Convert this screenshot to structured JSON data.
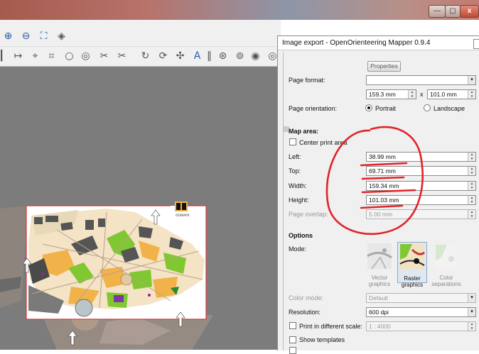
{
  "window": {
    "minimize_glyph": "—",
    "restore_glyph": "▢",
    "close_glyph": "x"
  },
  "toolbar": {
    "icons": [
      "zoom-in-icon",
      "zoom-out-icon",
      "fit-view-icon",
      "layer-icon"
    ]
  },
  "map": {
    "logo_letters": "M P S",
    "logo_caption": "OOMAPS"
  },
  "dialog": {
    "title": "Image export - OpenOrienteering Mapper 0.9.4",
    "properties_button": "Properties",
    "page_format_label": "Page format:",
    "page_format_value": "",
    "page_width": "159.3 mm",
    "page_times": "x",
    "page_height": "101.0 mm",
    "orientation_label": "Page orientation:",
    "portrait": "Portrait",
    "landscape": "Landscape",
    "map_area_heading": "Map area:",
    "center_print_area": "Center print area",
    "left_label": "Left:",
    "left_value": "38.99 mm",
    "top_label": "Top:",
    "top_value": "69.71 mm",
    "width_label": "Width:",
    "width_value": "159.34 mm",
    "height_label": "Height:",
    "height_value": "101.03 mm",
    "overlap_label": "Page overlap:",
    "overlap_value": "5.00 mm",
    "options_heading": "Options",
    "mode_label": "Mode:",
    "mode_vector": "Vector graphics",
    "mode_raster": "Raster graphics",
    "mode_color": "Color separations",
    "color_mode_label": "Color mode:",
    "color_mode_value": "Default",
    "resolution_label": "Resolution:",
    "resolution_value": "600 dpi",
    "print_scale_label": "Print in different scale:",
    "print_scale_value": "1 : 4000",
    "show_templates": "Show templates"
  },
  "colors": {
    "annotation_red": "#e0232a",
    "print_frame": "#d33a3a",
    "map_green": "#7fc832",
    "map_orange": "#f2b24a",
    "map_gray": "#7c7c7c"
  }
}
